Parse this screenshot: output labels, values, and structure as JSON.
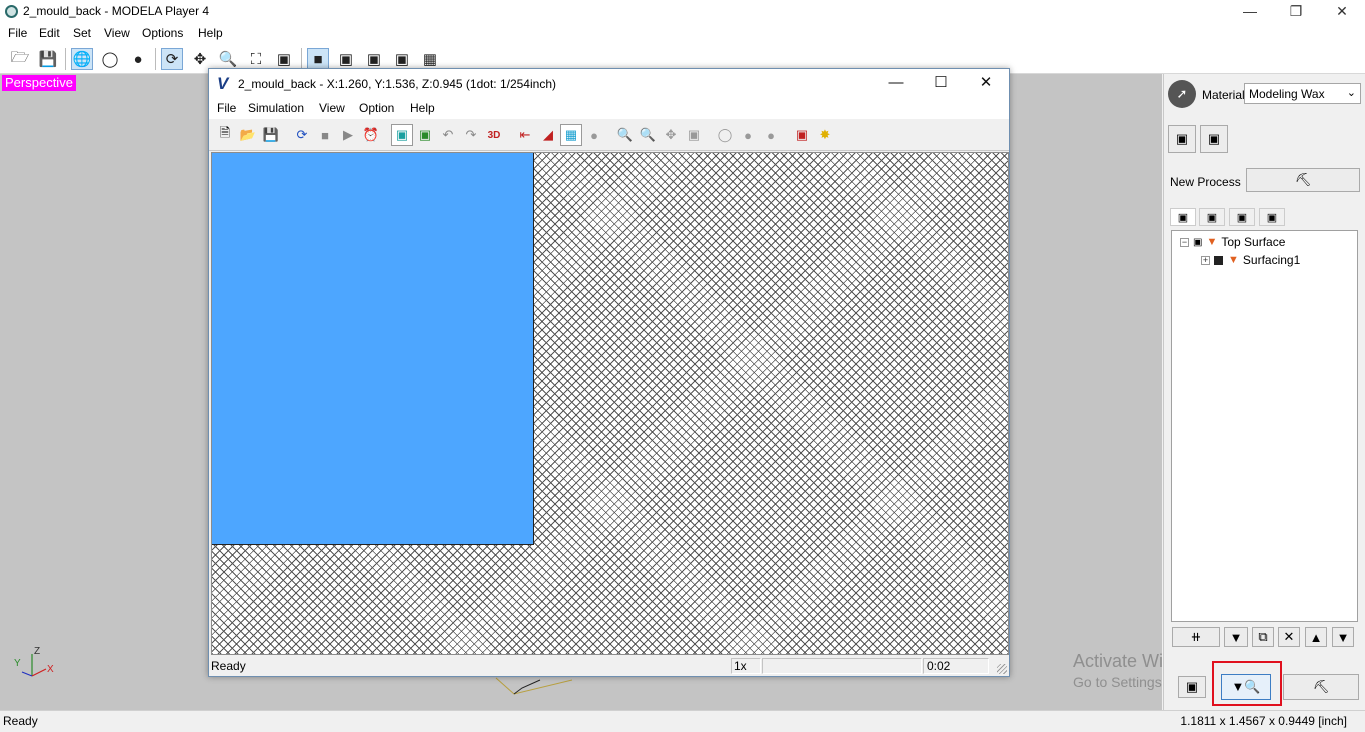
{
  "app": {
    "title": "2_mould_back - MODELA Player 4",
    "menu": [
      "File",
      "Edit",
      "Set",
      "View",
      "Options",
      "Help"
    ]
  },
  "main_toolbar": {
    "icons": [
      "open-icon",
      "save-icon",
      "wireframe-sphere-icon",
      "globe-icon",
      "shaded-sphere-icon",
      "rotate-icon",
      "pan-icon",
      "zoom-icon",
      "fit-icon",
      "zoom-box-icon",
      "view-cube-front-icon",
      "view-cube-top-icon",
      "view-cube-right-icon",
      "view-cube-iso-icon",
      "four-views-icon"
    ]
  },
  "viewport": {
    "mode_label": "Perspective",
    "axis_labels": {
      "y": "Y",
      "z": "Z",
      "x": "X"
    }
  },
  "simulation_window": {
    "title": "2_mould_back - X:1.260, Y:1.536, Z:0.945 (1dot: 1/254inch)",
    "menu": [
      "File",
      "Simulation",
      "View",
      "Option",
      "Help"
    ],
    "status": {
      "text": "Ready",
      "speed": "1x",
      "time": "0:02"
    },
    "colors": {
      "workpiece": "#4da6ff"
    }
  },
  "right_panel": {
    "material_label": "Material",
    "material_value": "Modeling Wax",
    "new_process_label": "New Process",
    "tree": [
      {
        "label": "Top Surface",
        "level": 0
      },
      {
        "label": "Surfacing1",
        "level": 1
      }
    ]
  },
  "watermark": {
    "line1": "Activate Windows",
    "line2": "Go to Settings to activate Windows."
  },
  "statusbar": {
    "left": "Ready",
    "right": "1.1811 x 1.4567 x 0.9449 [inch]"
  },
  "colors": {
    "highlight_box": "#e0101e",
    "perspective_badge": "#ff00ff"
  }
}
